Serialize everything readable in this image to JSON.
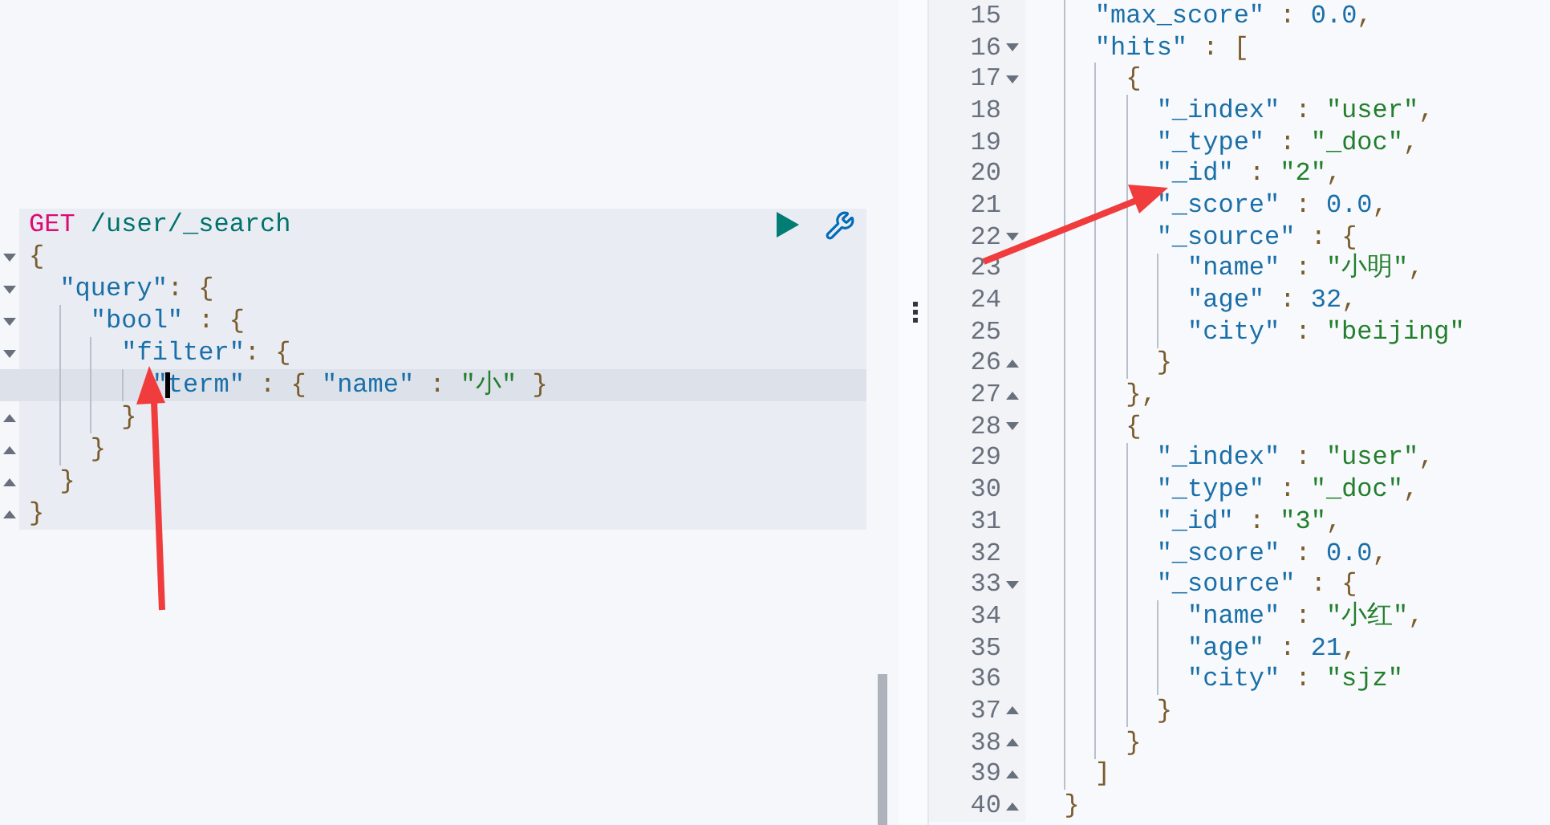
{
  "request": {
    "method": "GET",
    "path": "/user/_search"
  },
  "editor_lines": [
    {
      "code": "{",
      "expanded": true,
      "selected": false,
      "cursor": false
    },
    {
      "code": "  \"query\": {",
      "expanded": true,
      "selected": false,
      "cursor": false
    },
    {
      "code": "    \"bool\" : {",
      "expanded": true,
      "selected": false,
      "cursor": false
    },
    {
      "code": "      \"filter\": {",
      "expanded": true,
      "selected": false,
      "cursor": false
    },
    {
      "code": "        \"term\" : { \"name\" : \"小\" }",
      "selected": true,
      "cursor": true
    },
    {
      "code": "      }",
      "expanded": false,
      "selected": false,
      "cursor": false
    },
    {
      "code": "    }",
      "expanded": false,
      "selected": false,
      "cursor": false
    },
    {
      "code": "  }",
      "expanded": false,
      "selected": false,
      "cursor": false
    },
    {
      "code": "}",
      "expanded": false,
      "selected": false,
      "cursor": false
    }
  ],
  "response_lines": [
    {
      "number": "15",
      "code": "    \"max_score\" : 0.0,"
    },
    {
      "number": "16",
      "code": "    \"hits\" : [",
      "expanded": true
    },
    {
      "number": "17",
      "code": "      {",
      "expanded": true
    },
    {
      "number": "18",
      "code": "        \"_index\" : \"user\","
    },
    {
      "number": "19",
      "code": "        \"_type\" : \"_doc\","
    },
    {
      "number": "20",
      "code": "        \"_id\" : \"2\","
    },
    {
      "number": "21",
      "code": "        \"_score\" : 0.0,"
    },
    {
      "number": "22",
      "code": "        \"_source\" : {",
      "expanded": true
    },
    {
      "number": "23",
      "code": "          \"name\" : \"小明\","
    },
    {
      "number": "24",
      "code": "          \"age\" : 32,"
    },
    {
      "number": "25",
      "code": "          \"city\" : \"beijing\""
    },
    {
      "number": "26",
      "code": "        }",
      "expanded": false
    },
    {
      "number": "27",
      "code": "      },",
      "expanded": false
    },
    {
      "number": "28",
      "code": "      {",
      "expanded": true
    },
    {
      "number": "29",
      "code": "        \"_index\" : \"user\","
    },
    {
      "number": "30",
      "code": "        \"_type\" : \"_doc\","
    },
    {
      "number": "31",
      "code": "        \"_id\" : \"3\","
    },
    {
      "number": "32",
      "code": "        \"_score\" : 0.0,"
    },
    {
      "number": "33",
      "code": "        \"_source\" : {",
      "expanded": true
    },
    {
      "number": "34",
      "code": "          \"name\" : \"小红\","
    },
    {
      "number": "35",
      "code": "          \"age\" : 21,"
    },
    {
      "number": "36",
      "code": "          \"city\" : \"sjz\""
    },
    {
      "number": "37",
      "code": "        }",
      "expanded": false
    },
    {
      "number": "38",
      "code": "      }",
      "expanded": false
    },
    {
      "number": "39",
      "code": "    ]",
      "expanded": false
    },
    {
      "number": "40",
      "code": "  }",
      "expanded": false
    }
  ]
}
